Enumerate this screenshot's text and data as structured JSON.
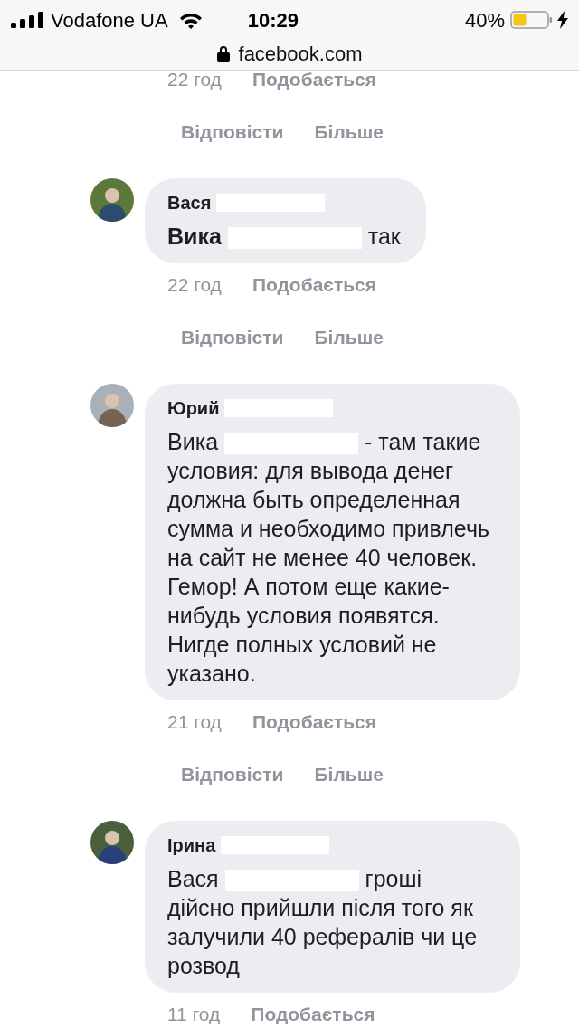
{
  "status_bar": {
    "carrier": "Vodafone UA",
    "time": "10:29",
    "battery": "40%"
  },
  "address_bar": {
    "url": "facebook.com"
  },
  "top_fragment": {
    "time": "22 год",
    "like": "Подобається",
    "reply": "Відповісти",
    "more": "Більше"
  },
  "comments": [
    {
      "author": "Вася",
      "author_redacted": true,
      "body_before": "**Вика**",
      "body_redacted": true,
      "body_after": "так",
      "time": "22 год",
      "like": "Подобається",
      "reply": "Відповісти",
      "more": "Більше"
    },
    {
      "author": "Юрий",
      "author_redacted": true,
      "body_before": "Вика",
      "body_redacted": true,
      "body_after": "- там такие условия: для вывода денег должна быть определенная сумма и необходимо привлечь на сайт не менее 40 человек. Гемор! А потом еще какие-нибудь условия появятся. Нигде полных условий не указано.",
      "time": "21 год",
      "like": "Подобається",
      "reply": "Відповісти",
      "more": "Більше"
    },
    {
      "author": "Ірина",
      "author_redacted": true,
      "body_before": "Вася",
      "body_redacted": true,
      "body_after": "гроші дійсно прийшли після того як залучили 40 рефералів чи це розвод",
      "time": "11 год",
      "like": "Подобається"
    }
  ]
}
